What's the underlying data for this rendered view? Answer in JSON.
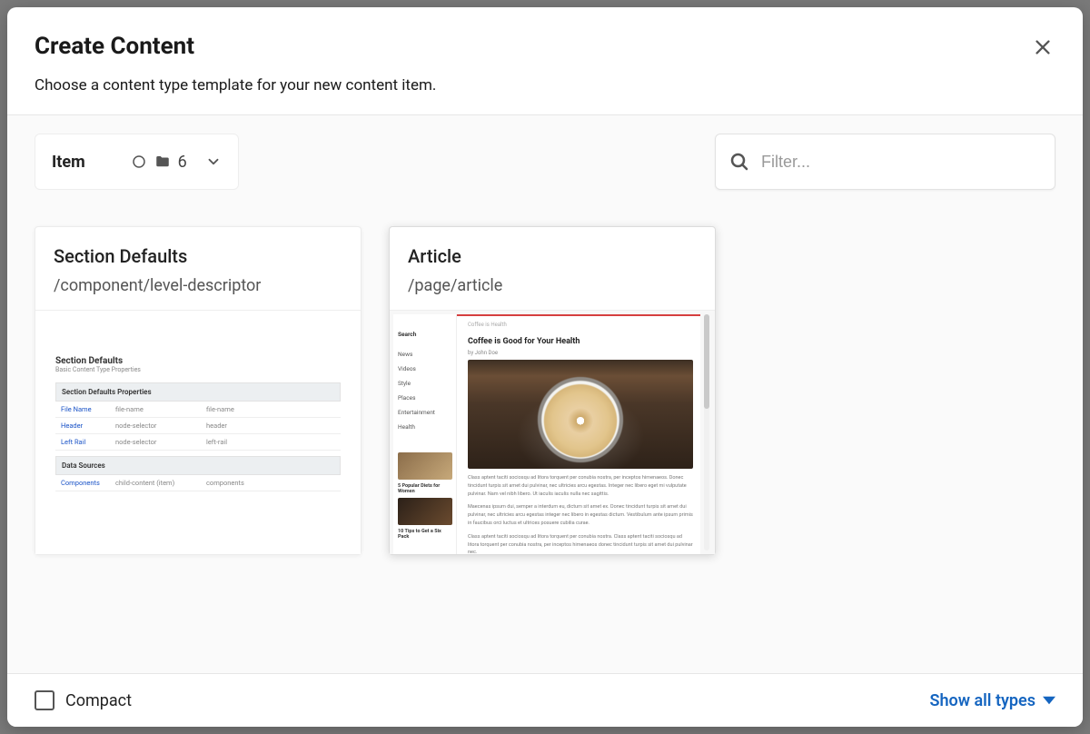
{
  "modal": {
    "title": "Create Content",
    "subtitle": "Choose a content type template for your new content item.",
    "close_icon": "close"
  },
  "selector": {
    "label": "Item",
    "count": "6",
    "icon": "folder"
  },
  "filter": {
    "placeholder": "Filter...",
    "value": ""
  },
  "cards": [
    {
      "title": "Section Defaults",
      "path": "/component/level-descriptor",
      "preview": {
        "heading": "Section Defaults",
        "sub": "Basic Content Type Properties",
        "section1": "Section Defaults Properties",
        "rows1": [
          {
            "k": "File Name",
            "m": "file-name",
            "v": "file-name"
          },
          {
            "k": "Header",
            "m": "node-selector",
            "v": "header"
          },
          {
            "k": "Left Rail",
            "m": "node-selector",
            "v": "left-rail"
          }
        ],
        "section2": "Data Sources",
        "rows2": [
          {
            "k": "Components",
            "m": "child-content (item)",
            "v": "components"
          }
        ]
      }
    },
    {
      "title": "Article",
      "path": "/page/article",
      "selected": true,
      "preview": {
        "side_items": [
          "News",
          "Videos",
          "Style",
          "Places",
          "Entertainment",
          "Health"
        ],
        "headline": "Coffee is Good for Your Health",
        "author": "by John Doe",
        "breadcrumb": "Coffee is Health"
      }
    }
  ],
  "footer": {
    "compact_label": "Compact",
    "show_all_label": "Show all types"
  }
}
